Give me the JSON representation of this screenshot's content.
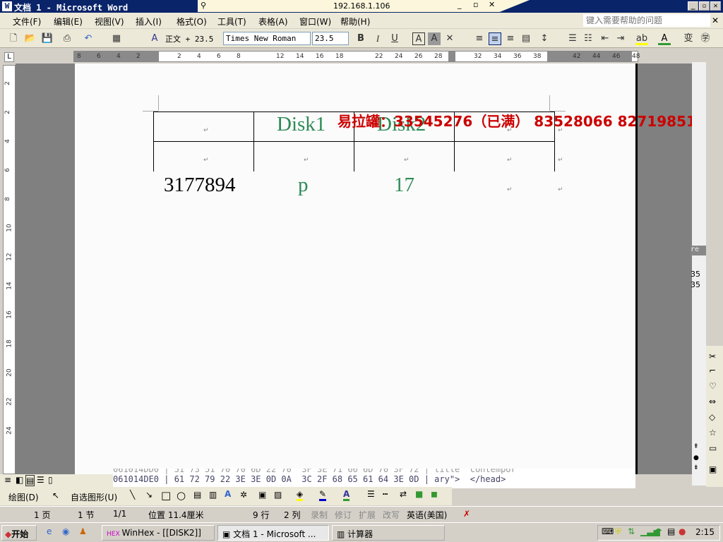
{
  "window": {
    "title": "文档 1 - Microsoft Word",
    "remote_host": "192.168.1.106"
  },
  "menu": [
    "文件(F)",
    "编辑(E)",
    "视图(V)",
    "插入(I)",
    "格式(O)",
    "工具(T)",
    "表格(A)",
    "窗口(W)",
    "帮助(H)"
  ],
  "help_placeholder": "键入需要帮助的问题",
  "toolbar": {
    "style": "正文 + 23.5",
    "font": "Times New Roman",
    "size": "23.5"
  },
  "ruler": {
    "top": [
      "8",
      "6",
      "4",
      "2",
      "2",
      "4",
      "6",
      "8",
      "12",
      "14",
      "16",
      "18",
      "22",
      "24",
      "26",
      "28",
      "32",
      "34",
      "36",
      "38",
      "42",
      "44",
      "46",
      "48"
    ],
    "left": [
      "2",
      "2",
      "4",
      "6",
      "8",
      "10",
      "12",
      "14",
      "16",
      "18",
      "20",
      "22",
      "24"
    ]
  },
  "document": {
    "table_header": [
      "",
      "Disk1",
      "Disk2",
      ""
    ],
    "row3": [
      "3177894",
      "p",
      "17",
      ""
    ],
    "overlay": "易拉罐：33545276（已满） 83528066  82719851",
    "para_mark": "↵"
  },
  "hex": {
    "line1": "061014DD0 | 51 73 51 70 70 6D 22 70  3F 3E 71 66 6D 70 3F 72 | title  contempor",
    "line2": "061014DE0 | 61 72 79 22 3E 3E 0D 0A  3C 2F 68 65 61 64 3E 0D | ary\">  </head>"
  },
  "side_panel": {
    "header": "re",
    "v1": "35",
    "v2": "35"
  },
  "draw_toolbar": {
    "draw": "绘图(D)",
    "autoshape": "自选图形(U)"
  },
  "status": {
    "page": "1 页",
    "section": "1 节",
    "pages": "1/1",
    "position": "位置 11.4厘米",
    "line": "9 行",
    "col": "2 列",
    "rec": "录制",
    "trk": "修订",
    "ext": "扩展",
    "ovr": "改写",
    "lang": "英语(美国)"
  },
  "taskbar": {
    "start": "开始",
    "tasks": [
      "WinHex - [[DISK2]]",
      "文档 1 - Microsoft ...",
      "计算器"
    ],
    "clock": "2:15"
  },
  "colors": {
    "title": "#0a246a",
    "green_text": "#2e8b57",
    "red_text": "#cc0000"
  }
}
